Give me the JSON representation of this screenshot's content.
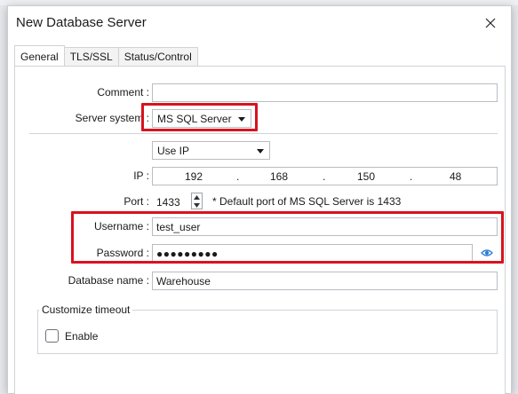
{
  "dialog": {
    "title": "New Database Server",
    "close_icon": "close-icon"
  },
  "tabs": [
    {
      "label": "General",
      "active": true
    },
    {
      "label": "TLS/SSL",
      "active": false
    },
    {
      "label": "Status/Control",
      "active": false
    }
  ],
  "form": {
    "comment_label": "Comment :",
    "comment_value": "",
    "server_system_label": "Server system :",
    "server_system_value": "MS SQL Server",
    "address_mode_value": "Use IP",
    "ip_label": "IP :",
    "ip": [
      "192",
      "168",
      "150",
      "48"
    ],
    "ip_dots": [
      ".",
      ".",
      "."
    ],
    "port_label": "Port :",
    "port_value": "1433",
    "port_note": "* Default port of MS SQL Server is 1433",
    "username_label": "Username :",
    "username_value": "test_user",
    "password_label": "Password :",
    "password_value": "●●●●●●●●●",
    "database_label": "Database name :",
    "database_value": "Warehouse"
  },
  "timeout": {
    "group_title": "Customize timeout",
    "enable_label": "Enable",
    "enabled": false
  },
  "colors": {
    "highlight": "#d8121e",
    "eye_icon": "#2d7fd3"
  }
}
